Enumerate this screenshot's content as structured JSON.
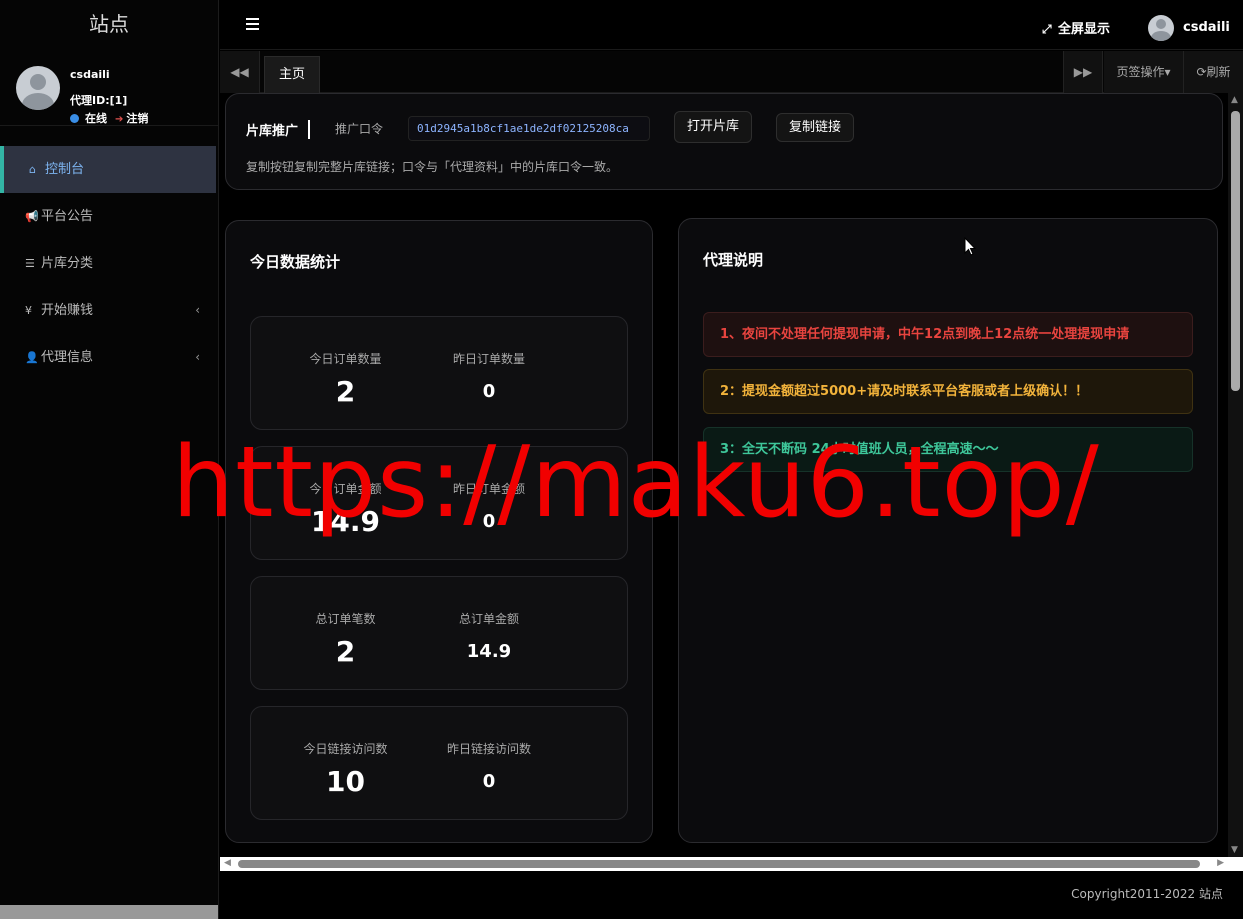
{
  "sidebar": {
    "site_title": "站点",
    "user": {
      "name": "csdaili",
      "agent_id": "代理ID:[1]",
      "status": "在线",
      "logout": "注销"
    },
    "menu": [
      {
        "label": "控制台",
        "icon": "home-icon"
      },
      {
        "label": "平台公告",
        "icon": "bullhorn-icon"
      },
      {
        "label": "片库分类",
        "icon": "list-icon"
      },
      {
        "label": "开始赚钱",
        "icon": "yen-icon"
      },
      {
        "label": "代理信息",
        "icon": "user-icon"
      }
    ]
  },
  "header": {
    "fullscreen_label": "全屏显示",
    "username": "csdaili"
  },
  "tabs": {
    "home_label": "主页",
    "tab_ops_label": "页签操作",
    "refresh_label": "刷新"
  },
  "promo": {
    "title": "片库推广",
    "code_label": "推广口令",
    "code_value": "01d2945a1b8cf1ae1de2df02125208ca",
    "open_button": "打开片库",
    "copy_button": "复制链接",
    "tip": "复制按钮复制完整片库链接；口令与「代理资料」中的片库口令一致。"
  },
  "stats": {
    "title": "今日数据统计",
    "boxes": [
      {
        "left_label": "今日订单数量",
        "left_value": "2",
        "right_label": "昨日订单数量",
        "right_value": "0"
      },
      {
        "left_label": "今日订单金额",
        "left_value": "14.9",
        "right_label": "昨日订单金额",
        "right_value": "0"
      },
      {
        "left_label": "总订单笔数",
        "left_value": "2",
        "right_label": "总订单金额",
        "right_value": "14.9"
      },
      {
        "left_label": "今日链接访问数",
        "left_value": "10",
        "right_label": "昨日链接访问数",
        "right_value": "0"
      }
    ]
  },
  "agent_notes": {
    "title": "代理说明",
    "notices": [
      {
        "text": "1、夜间不处理任何提现申请，中午12点到晚上12点统一处理提现申请",
        "color": "#e8443f"
      },
      {
        "text": "2：提现金额超过5000+请及时联系平台客服或者上级确认！！",
        "color": "#f2b33b"
      },
      {
        "text": "3：全天不断码 24小时值班人员，全程高速～～",
        "color": "#3ec79a"
      }
    ]
  },
  "footer": {
    "copyright": "Copyright2011-2022 站点"
  },
  "watermark": {
    "text": "https://maku6.top/",
    "color": "#f10000"
  }
}
